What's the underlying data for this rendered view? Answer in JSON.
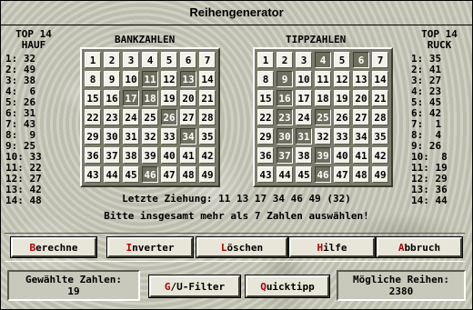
{
  "window": {
    "title": "Reihengenerator"
  },
  "left_panel": {
    "heading1": "TOP 14",
    "heading2": "HAUF",
    "rows": [
      "1: 32",
      "2: 49",
      "3: 38",
      "4:  6",
      "5: 26",
      "6: 31",
      "7: 43",
      "8:  9",
      "9: 25",
      "10: 33",
      "11: 22",
      "12: 27",
      "13: 42",
      "14: 48"
    ]
  },
  "right_panel": {
    "heading1": "TOP 14",
    "heading2": "RUCK",
    "rows": [
      "1: 35",
      "2: 41",
      "3: 27",
      "4: 23",
      "5: 45",
      "6: 42",
      "7:  1",
      "8:  4",
      "9: 26",
      "10:  8",
      "11: 19",
      "12: 29",
      "13: 36",
      "14: 44"
    ]
  },
  "bankzahlen": {
    "label": "BANKZAHLEN",
    "numbers": [
      1,
      2,
      3,
      4,
      5,
      6,
      7,
      8,
      9,
      10,
      11,
      12,
      13,
      14,
      15,
      16,
      17,
      18,
      19,
      20,
      21,
      22,
      23,
      24,
      25,
      26,
      27,
      28,
      29,
      30,
      31,
      32,
      33,
      34,
      35,
      36,
      37,
      38,
      39,
      40,
      41,
      42,
      43,
      44,
      45,
      46,
      47,
      48,
      49
    ],
    "selected": [
      11,
      13,
      17,
      18,
      26,
      34,
      46
    ]
  },
  "tippzahlen": {
    "label": "TIPPZAHLEN",
    "numbers": [
      1,
      2,
      3,
      4,
      5,
      6,
      7,
      8,
      9,
      10,
      11,
      12,
      13,
      14,
      15,
      16,
      17,
      18,
      19,
      20,
      21,
      22,
      23,
      24,
      25,
      26,
      27,
      28,
      29,
      30,
      31,
      32,
      33,
      34,
      35,
      36,
      37,
      38,
      39,
      40,
      41,
      42,
      43,
      44,
      45,
      46,
      47,
      48,
      49
    ],
    "selected": [
      4,
      6,
      9,
      16,
      23,
      25,
      30,
      31,
      37,
      39,
      46
    ]
  },
  "info": {
    "last_draw": "Letzte Ziehung: 11 13 17 34 46 49 (32)",
    "hint": "Bitte insgesamt mehr als 7 Zahlen auswählen!"
  },
  "buttons": {
    "berechne": {
      "accel": "B",
      "rest": "erechne"
    },
    "inverter": {
      "accel": "I",
      "rest": "nverter"
    },
    "loeschen": {
      "accel": "L",
      "rest": "öschen"
    },
    "hilfe": {
      "accel": "H",
      "rest": "ilfe"
    },
    "abbruch": {
      "accel": "A",
      "rest": "bbruch"
    },
    "guv_filter": {
      "accel": "G",
      "rest": "/U-Filter"
    },
    "quicktipp": {
      "accel": "Q",
      "rest": "uicktipp"
    }
  },
  "status": {
    "gewaehlte_label": "Gewählte Zahlen:",
    "gewaehlte_value": "19",
    "moegliche_label": "Mögliche Reihen:",
    "moegliche_value": "2380"
  }
}
